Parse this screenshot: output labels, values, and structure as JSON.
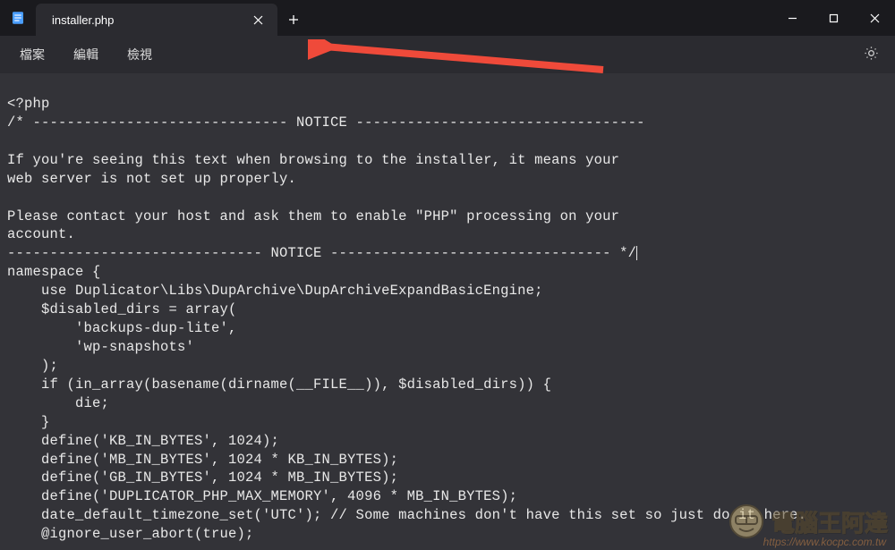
{
  "tab": {
    "title": "installer.php"
  },
  "menu": {
    "file": "檔案",
    "edit": "編輯",
    "view": "檢視"
  },
  "code": {
    "l1": "<?php",
    "l2": "/* ------------------------------ NOTICE ----------------------------------",
    "l3": "",
    "l4": "If you're seeing this text when browsing to the installer, it means your",
    "l5": "web server is not set up properly.",
    "l6": "",
    "l7": "Please contact your host and ask them to enable \"PHP\" processing on your",
    "l8": "account.",
    "l9": "------------------------------ NOTICE --------------------------------- */",
    "l10": "namespace {",
    "l11": "    use Duplicator\\Libs\\DupArchive\\DupArchiveExpandBasicEngine;",
    "l12": "    $disabled_dirs = array(",
    "l13": "        'backups-dup-lite',",
    "l14": "        'wp-snapshots'",
    "l15": "    );",
    "l16": "    if (in_array(basename(dirname(__FILE__)), $disabled_dirs)) {",
    "l17": "        die;",
    "l18": "    }",
    "l19": "    define('KB_IN_BYTES', 1024);",
    "l20": "    define('MB_IN_BYTES', 1024 * KB_IN_BYTES);",
    "l21": "    define('GB_IN_BYTES', 1024 * MB_IN_BYTES);",
    "l22": "    define('DUPLICATOR_PHP_MAX_MEMORY', 4096 * MB_IN_BYTES);",
    "l23": "    date_default_timezone_set('UTC'); // Some machines don't have this set so just do it here.",
    "l24": "    @ignore_user_abort(true);"
  },
  "watermark": {
    "text": "電腦王阿達",
    "url": "https://www.kocpc.com.tw"
  }
}
